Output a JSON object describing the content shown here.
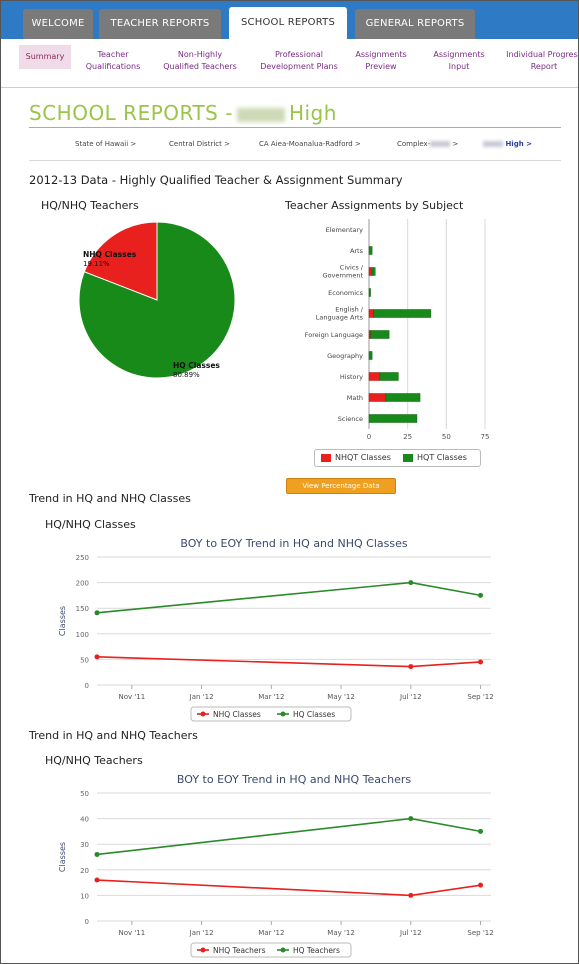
{
  "tabs": [
    {
      "label": "WELCOME"
    },
    {
      "label": "TEACHER REPORTS"
    },
    {
      "label": "SCHOOL REPORTS"
    },
    {
      "label": "GENERAL REPORTS"
    }
  ],
  "subnav": [
    {
      "label": "Summary"
    },
    {
      "label": "Teacher Qualifications"
    },
    {
      "label": "Non-Highly Qualified Teachers"
    },
    {
      "label": "Professional Development Plans"
    },
    {
      "label": "Assignments Preview"
    },
    {
      "label": "Assignments Input"
    },
    {
      "label": "Individual Progress Report"
    }
  ],
  "page": {
    "title_prefix": "SCHOOL REPORTS -",
    "title_suffix": "High"
  },
  "breadcrumb": [
    "State of Hawaii >",
    "Central District >",
    "CA Aiea-Moanalua-Radford >",
    "Complex-",
    ">",
    "High >"
  ],
  "section_title": "2012-13 Data - Highly Qualified Teacher & Assignment Summary",
  "pie": {
    "title": "HQ/NHQ Teachers",
    "slices": [
      {
        "label": "NHQ Classes",
        "pct_label": "19.11%",
        "value": 19.11,
        "color": "#e8201e"
      },
      {
        "label": "HQ Classes",
        "pct_label": "80.89%",
        "value": 80.89,
        "color": "#188a1a"
      }
    ]
  },
  "bar": {
    "title": "Teacher Assignments by Subject",
    "categories": [
      "Elementary",
      "Arts",
      "Civics / Government",
      "Economics",
      "English / Language Arts",
      "Foreign Language",
      "Geography",
      "History",
      "Math",
      "Science"
    ],
    "nhqt": [
      0,
      0,
      2,
      0,
      3,
      1,
      0,
      7,
      11,
      0
    ],
    "hqt": [
      0,
      2,
      2,
      1,
      37,
      12,
      2,
      12,
      22,
      31
    ],
    "ticks": [
      "0",
      "25",
      "50",
      "75"
    ],
    "legend": [
      "NHQT Classes",
      "HQT Classes"
    ]
  },
  "button_label": "View Percentage Data",
  "trend_classes": {
    "section": "Trend in HQ and NHQ Classes",
    "subtitle": "HQ/NHQ Classes",
    "title": "BOY to EOY Trend in HQ and NHQ Classes",
    "ylabel": "Classes",
    "yticks": [
      "0",
      "50",
      "100",
      "150",
      "200",
      "250"
    ],
    "xticks": [
      "Nov '11",
      "Jan '12",
      "Mar '12",
      "May '12",
      "Jul '12",
      "Sep '12"
    ],
    "legend": [
      "NHQ Classes",
      "HQ Classes"
    ]
  },
  "trend_teachers": {
    "section": "Trend in HQ and NHQ Teachers",
    "subtitle": "HQ/NHQ Teachers",
    "title": "BOY to EOY Trend in HQ and NHQ Teachers",
    "ylabel": "Classes",
    "yticks": [
      "0",
      "10",
      "20",
      "30",
      "40",
      "50"
    ],
    "xticks": [
      "Nov '11",
      "Jan '12",
      "Mar '12",
      "May '12",
      "Jul '12",
      "Sep '12"
    ],
    "legend": [
      "NHQ Teachers",
      "HQ Teachers"
    ]
  },
  "chart_data": [
    {
      "type": "pie",
      "title": "HQ/NHQ Teachers",
      "labels": [
        "NHQ Classes",
        "HQ Classes"
      ],
      "values": [
        19.11,
        80.89
      ]
    },
    {
      "type": "bar",
      "title": "Teacher Assignments by Subject",
      "categories": [
        "Elementary",
        "Arts",
        "Civics / Government",
        "Economics",
        "English / Language Arts",
        "Foreign Language",
        "Geography",
        "History",
        "Math",
        "Science"
      ],
      "series": [
        {
          "name": "NHQT Classes",
          "values": [
            0,
            0,
            2,
            0,
            3,
            1,
            0,
            7,
            11,
            0
          ]
        },
        {
          "name": "HQT Classes",
          "values": [
            0,
            2,
            2,
            1,
            37,
            12,
            2,
            12,
            22,
            31
          ]
        }
      ],
      "xlim": [
        0,
        75
      ]
    },
    {
      "type": "line",
      "title": "BOY to EOY Trend in HQ and NHQ Classes",
      "ylabel": "Classes",
      "x": [
        "2011-10",
        "2012-07",
        "2012-09"
      ],
      "series": [
        {
          "name": "NHQ Classes",
          "values": [
            55,
            36,
            45
          ]
        },
        {
          "name": "HQ Classes",
          "values": [
            141,
            200,
            175
          ]
        }
      ],
      "ylim": [
        0,
        250
      ]
    },
    {
      "type": "line",
      "title": "BOY to EOY Trend in HQ and NHQ Teachers",
      "ylabel": "Classes",
      "x": [
        "2011-10",
        "2012-07",
        "2012-09"
      ],
      "series": [
        {
          "name": "NHQ Teachers",
          "values": [
            16,
            10,
            14
          ]
        },
        {
          "name": "HQ Teachers",
          "values": [
            26,
            40,
            35
          ]
        }
      ],
      "ylim": [
        0,
        50
      ]
    }
  ]
}
